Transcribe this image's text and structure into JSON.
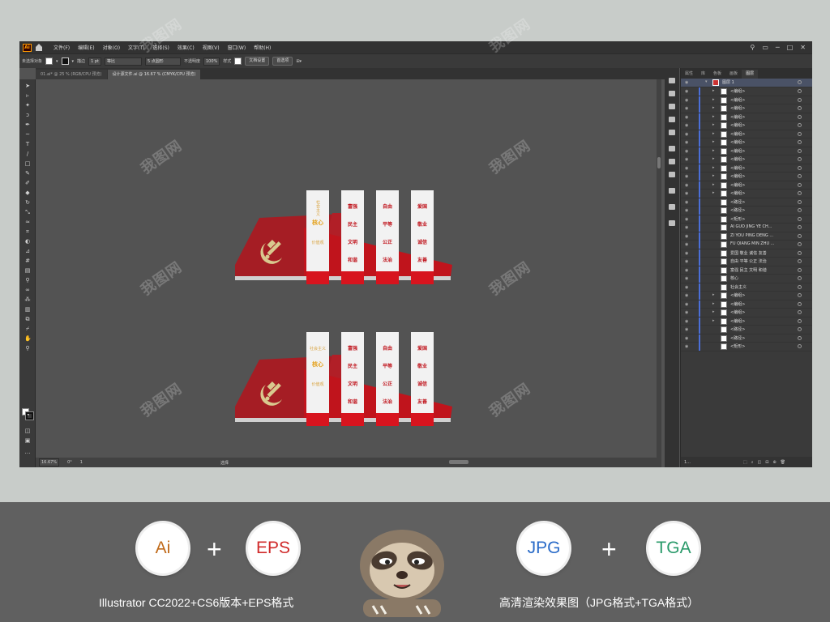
{
  "menubar": {
    "app_icon": "Ai",
    "items": [
      "文件(F)",
      "编辑(E)",
      "对象(O)",
      "文字(T)",
      "选择(S)",
      "效果(C)",
      "视图(V)",
      "窗口(W)",
      "帮助(H)"
    ],
    "window_controls": [
      "─",
      "□",
      "✕"
    ]
  },
  "controlbar": {
    "selection": "未选择对象",
    "stroke_label": "描边",
    "stroke_value": "1 pt",
    "profile": "等比",
    "brush": "5 点圆形",
    "opacity_label": "不透明度",
    "opacity_value": "100%",
    "style_label": "样式",
    "doc_setup": "文档设置",
    "preferences": "首选项"
  },
  "tabs": [
    {
      "label": "01.ai* @ 25 % (RGB/CPU 预览)",
      "active": false
    },
    {
      "label": "设计源文件.ai @ 16.67 % (CMYK/CPU 预览)",
      "active": true
    }
  ],
  "statusbar": {
    "zoom": "16.67%",
    "angle": "0°",
    "page": "1",
    "tool": "选择"
  },
  "panel": {
    "tabs": [
      "属性",
      "库",
      "色板",
      "画板",
      "图层"
    ],
    "active_tab": "图层",
    "root_layer": "图层 1",
    "layers": [
      {
        "name": "<编组>",
        "expand": true
      },
      {
        "name": "<编组>",
        "expand": true
      },
      {
        "name": "<编组>",
        "expand": true
      },
      {
        "name": "<编组>",
        "expand": true
      },
      {
        "name": "<编组>",
        "expand": true
      },
      {
        "name": "<编组>",
        "expand": true
      },
      {
        "name": "<编组>",
        "expand": true
      },
      {
        "name": "<编组>",
        "expand": true
      },
      {
        "name": "<编组>",
        "expand": true
      },
      {
        "name": "<编组>",
        "expand": true
      },
      {
        "name": "<编组>",
        "expand": true
      },
      {
        "name": "<编组>",
        "expand": true
      },
      {
        "name": "<编组>",
        "expand": true
      },
      {
        "name": "<路径>",
        "expand": false
      },
      {
        "name": "<路径>",
        "expand": false
      },
      {
        "name": "<矩形>",
        "expand": false
      },
      {
        "name": "AI GUO JING YE CH...",
        "expand": false
      },
      {
        "name": "ZI YOU PING DENG ...",
        "expand": false
      },
      {
        "name": "FU QIANG MIN ZHU ...",
        "expand": false
      },
      {
        "name": "爱国 敬业 诚信 友善",
        "expand": false
      },
      {
        "name": "自由 平等 公正 法治",
        "expand": false
      },
      {
        "name": "富强 民主 文明 和谐",
        "expand": false
      },
      {
        "name": "核心",
        "expand": false
      },
      {
        "name": "社会主义",
        "expand": false
      },
      {
        "name": "<编组>",
        "expand": true
      },
      {
        "name": "<编组>",
        "expand": true
      },
      {
        "name": "<编组>",
        "expand": true
      },
      {
        "name": "<编组>",
        "expand": true
      },
      {
        "name": "<路径>",
        "expand": false
      },
      {
        "name": "<路径>",
        "expand": false
      },
      {
        "name": "<矩形>",
        "expand": false
      }
    ],
    "footer": "1..."
  },
  "artwork": {
    "left_panel": {
      "line1": "社会主义",
      "line2": "核心",
      "line3": "价值观"
    },
    "columns": [
      [
        "富强",
        "民主",
        "文明",
        "和谐"
      ],
      [
        "自由",
        "平等",
        "公正",
        "法治"
      ],
      [
        "爱国",
        "敬业",
        "诚信",
        "友善"
      ]
    ]
  },
  "watermark": "我图网",
  "promo": {
    "badges": [
      "Ai",
      "EPS",
      "JPG",
      "TGA"
    ],
    "plus": "+",
    "caption_left": "Illustrator CC2022+CS6版本+EPS格式",
    "caption_right": "高清渲染效果图（JPG格式+TGA格式）"
  },
  "colors": {
    "party_red": "#c0141c",
    "dark_red": "#9b1b20",
    "gold": "#d9c98f",
    "ai_orange": "#ff9a00",
    "eps_red": "#d02a2a",
    "jpg_blue": "#2a6bc8",
    "tga_green": "#2a9a6a"
  }
}
